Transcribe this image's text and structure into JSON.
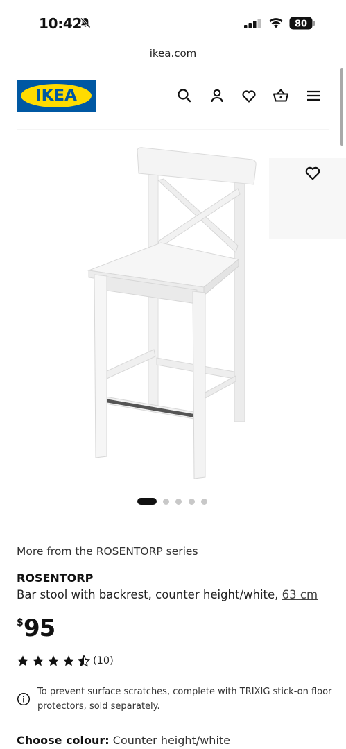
{
  "status_bar": {
    "time": "10:42",
    "battery": "80"
  },
  "browser": {
    "url": "ikea.com"
  },
  "header": {
    "logo_text": "IKEA",
    "icons": [
      "search-icon",
      "account-icon",
      "favourites-icon",
      "basket-icon",
      "menu-icon"
    ]
  },
  "gallery": {
    "image_count": 5,
    "active_index": 0
  },
  "product": {
    "series_link": "More from the ROSENTORP series",
    "name": "ROSENTORP",
    "description": "Bar stool with backrest, counter height/white, ",
    "size_link": "63 cm",
    "price_currency": "$",
    "price_amount": "95",
    "rating_stars": 4.5,
    "review_count": "(10)",
    "notice": "To prevent surface scratches, complete with TRIXIG stick-on floor protectors, sold separately.",
    "colour_label": "Choose colour:",
    "colour_value": "Counter height/white"
  },
  "colors": {
    "ikea_blue": "#0058a3",
    "ikea_yellow": "#ffdb00",
    "text": "#111111"
  }
}
